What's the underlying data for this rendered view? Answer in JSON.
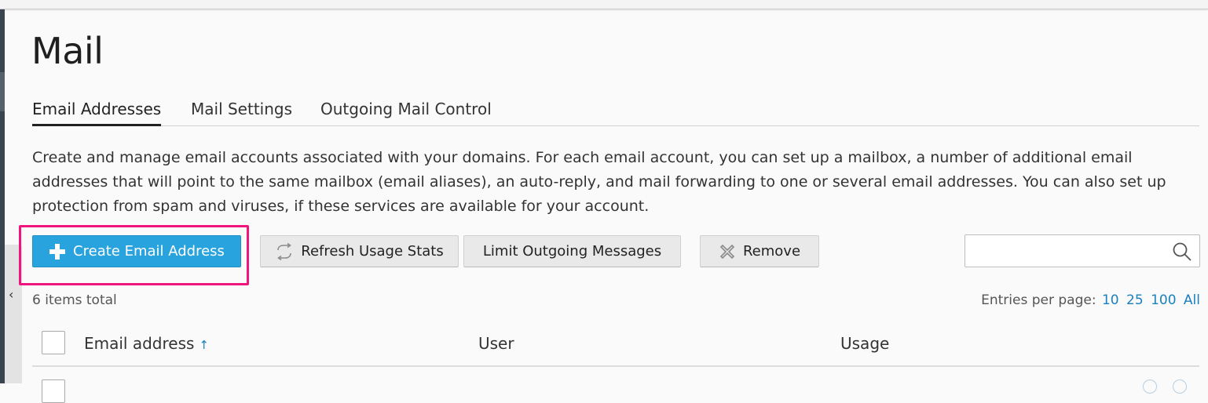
{
  "page": {
    "title": "Mail"
  },
  "tabs": [
    {
      "label": "Email Addresses",
      "active": true
    },
    {
      "label": "Mail Settings",
      "active": false
    },
    {
      "label": "Outgoing Mail Control",
      "active": false
    }
  ],
  "description": "Create and manage email accounts associated with your domains. For each email account, you can set up a mailbox, a number of additional email addresses that will point to the same mailbox (email aliases), an auto-reply, and mail forwarding to one or several email addresses. You can also set up protection from spam and viruses, if these services are available for your account.",
  "toolbar": {
    "create_label": "Create Email Address",
    "refresh_label": "Refresh Usage Stats",
    "limit_label": "Limit Outgoing Messages",
    "remove_label": "Remove",
    "search_value": "",
    "icons": {
      "create": "plus-icon",
      "refresh": "refresh-icon",
      "remove": "remove-x-icon",
      "search": "search-icon"
    }
  },
  "list": {
    "items_total": "6 items total",
    "entries_per_page_label": "Entries per page:",
    "page_sizes": [
      "10",
      "25",
      "100",
      "All"
    ]
  },
  "table": {
    "columns": [
      {
        "label": "Email address",
        "sort": "↑"
      },
      {
        "label": "User"
      },
      {
        "label": "Usage"
      }
    ]
  },
  "colors": {
    "primary_button": "#28a3dd",
    "highlight_border": "#f0157e",
    "link": "#1a80bf"
  }
}
